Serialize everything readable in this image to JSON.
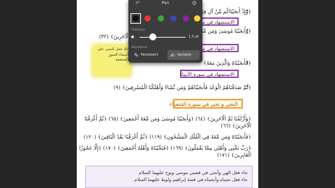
{
  "pen_panel": {
    "title": "Pen",
    "back_icon": "back-arrow-icon",
    "settings_icon": "gear-icon",
    "colors": [
      "#111111",
      "#e53935",
      "#43a047",
      "#3949ab",
      "#8e24aa",
      "#fdd835"
    ],
    "selected_color": "#111111",
    "thickness_label": "1.0 pt",
    "thickness_value": 1.0,
    "thickness_range": [
      0.5,
      6.0
    ],
    "mode_section_label": "Adjustment",
    "mode_top_label": "Thickness",
    "modes": [
      {
        "label": "Persistent",
        "icon": "pen-icon",
        "active": false
      },
      {
        "label": "Variable",
        "icon": "pen-variable-icon",
        "active": true
      }
    ]
  },
  "document": {
    "lines": [
      {
        "text": "﴿وَإِذْ أَنجَيْنَاكُم مِّنْ آلِ فِرْعَوْنَ﴾",
        "marker": "•"
      },
      {
        "text": "﴿وَأَنجَيْنَا مُوسَىٰ وَمَن مَّعَهُ﴾",
        "marker": "•"
      },
      {
        "text": "﴿ثُمَّ أَغْرَقْنَا الْآخَرِينَ﴾ (٣٢)",
        "marker": ""
      },
      {
        "text": "﴿فَأَنجَيْنَاهُ وَالَّذِينَ مَعَهُ﴾",
        "marker": "•"
      },
      {
        "text": "﴿وَلَقَدْ أَنجَيْنَا بَنِي إِسْرَائِيلَ﴾",
        "marker": "•"
      },
      {
        "text": "﴿ثُمَّ صَدَقْنَاهُمُ الْوَعْدَ فَأَنجَيْنَاهُمْ وَمَن نَّشَاءُ وَأَهْلَكْنَا الْمُسْرِفِينَ﴾ (٩)",
        "marker": "•"
      },
      {
        "text": "﴿وَأَزْلَفْنَا ثَمَّ الْآخَرِينَ﴾ (٦٤) ﴿وَأَنجَيْنَا مُوسَىٰ وَمَن مَّعَهُ أَجْمَعِينَ﴾ (٦٥) ﴿ثُمَّ أَغْرَقْنَا",
        "marker": "*"
      },
      {
        "text": "الْآخَرِينَ﴾ (٦٦)",
        "marker": ""
      },
      {
        "text": "﴿فَأَنجَيْنَاهُ وَمَن مَّعَهُ فِي الْفُلْكِ الْمَشْحُونِ﴾ (١١٩) ﴿ثُمَّ أَغْرَقْنَا بَعْدُ الْبَاقِينَ﴾ (١٢٠)",
        "marker": "*"
      },
      {
        "text": "﴿رَبِّ نَجِّنِي وَأَهْلِي مِمَّا يَعْمَلُونَ﴾ (١٦٩) ﴿فَنَجَّيْنَاهُ وَأَهْلَهُ أَجْمَعِينَ﴾ (١٧٠) ﴿إِلَّا عَجُوزًا فِي",
        "marker": "*"
      },
      {
        "text": "الْغَابِرِينَ﴾ (١٧١)",
        "marker": ""
      }
    ],
    "purple_boxes": [
      "الاستشهاد في سورة الأنبياء",
      "الاستشهاد في سورة الأنبياء",
      "الاستشهاد في سورة الأنبياء"
    ],
    "orange_box": "النجي و تجي في سورة الشعراء",
    "sticky_note": "عاد فعل النجي على أسماء السور المخففة",
    "bottom_tag": {
      "line1": "جاء فعل الهي وأنجى في قصتي موسى ونوح عليهما السلام",
      "line2": "جاء فعل نجيناه وأنجيناه في قصة إبراهيم ولوط عليهما السلام"
    }
  }
}
